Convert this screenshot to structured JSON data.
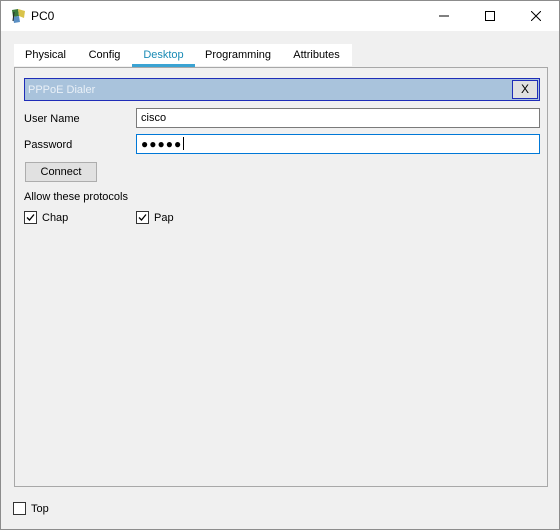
{
  "window": {
    "title": "PC0",
    "controls": {
      "minimize": "minimize",
      "maximize": "maximize",
      "close": "close"
    }
  },
  "tabs": [
    {
      "label": "Physical",
      "active": false
    },
    {
      "label": "Config",
      "active": false
    },
    {
      "label": "Desktop",
      "active": true
    },
    {
      "label": "Programming",
      "active": false
    },
    {
      "label": "Attributes",
      "active": false
    }
  ],
  "dialer": {
    "title": "PPPoE Dialer",
    "close_label": "X",
    "username_label": "User Name",
    "username_value": "cisco",
    "password_label": "Password",
    "password_masked": "●●●●●",
    "connect_label": "Connect",
    "protocols_label": "Allow these protocols",
    "protocols": [
      {
        "label": "Chap",
        "checked": true
      },
      {
        "label": "Pap",
        "checked": true
      }
    ]
  },
  "footer": {
    "top_label": "Top",
    "top_checked": false
  },
  "colors": {
    "accent": "#3aa3d3",
    "header_bg": "#a9c3dc",
    "header_border": "#1f2db8"
  }
}
